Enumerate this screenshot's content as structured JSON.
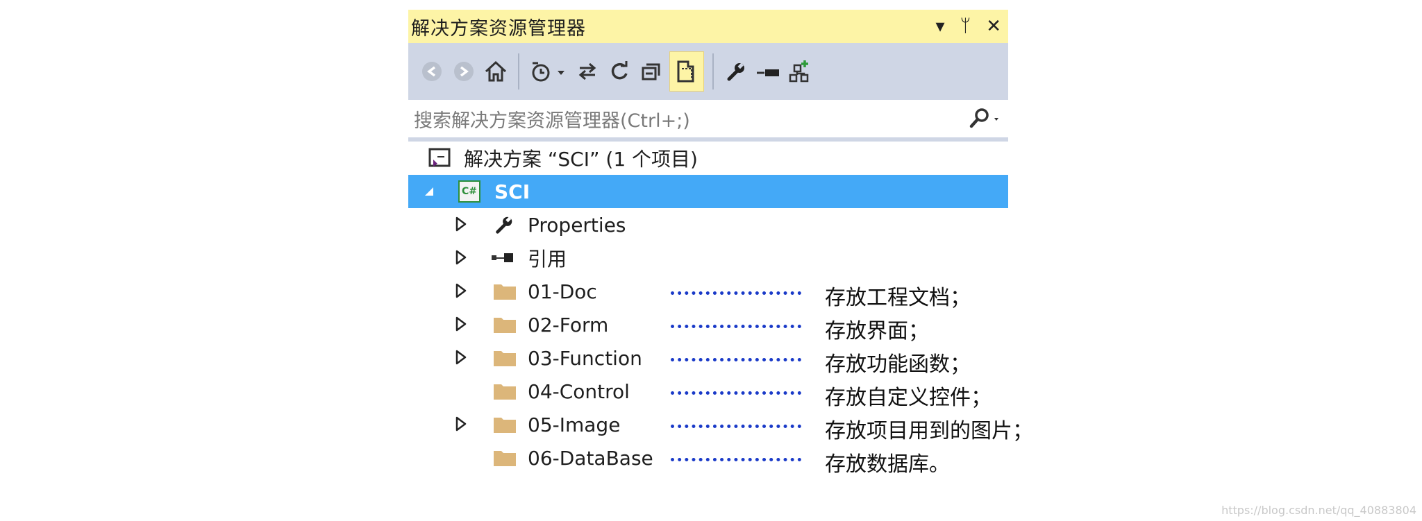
{
  "window": {
    "title": "解决方案资源管理器",
    "title_icons": [
      "dropdown-icon",
      "pin-icon",
      "close-icon"
    ],
    "title_glyphs": {
      "dropdown": "▾",
      "pin": "ᛘ",
      "close": "✕"
    }
  },
  "toolbar": {
    "buttons": [
      "back-icon",
      "forward-icon",
      "home-icon",
      "pending-changes-icon",
      "sync-icon",
      "refresh-icon",
      "collapse-all-icon",
      "show-all-files-icon",
      "properties-icon",
      "preview-icon",
      "new-solution-view-icon"
    ]
  },
  "search": {
    "placeholder": "搜索解决方案资源管理器(Ctrl+;)"
  },
  "tree": {
    "solution": "解决方案 “SCI” (1 个项目)",
    "project": "SCI",
    "project_badge": "C#",
    "items": [
      {
        "label": "Properties",
        "expandable": true
      },
      {
        "label": "引用",
        "expandable": true
      },
      {
        "label": "01-Doc",
        "expandable": true
      },
      {
        "label": "02-Form",
        "expandable": true
      },
      {
        "label": "03-Function",
        "expandable": true
      },
      {
        "label": "04-Control",
        "expandable": false
      },
      {
        "label": "05-Image",
        "expandable": true
      },
      {
        "label": "06-DataBase",
        "expandable": false
      }
    ]
  },
  "annotations": [
    "存放工程文档；",
    "存放界面；",
    "存放功能函数；",
    "存放自定义控件；",
    "存放项目用到的图片；",
    "存放数据库。"
  ],
  "watermark": "https://blog.csdn.net/qq_40883804",
  "colors": {
    "title_bg": "#fdf4a6",
    "toolbar_bg": "#cfd6e5",
    "selection": "#44a9f7",
    "folder": "#dcb67a",
    "dots": "#1a3ac8"
  }
}
